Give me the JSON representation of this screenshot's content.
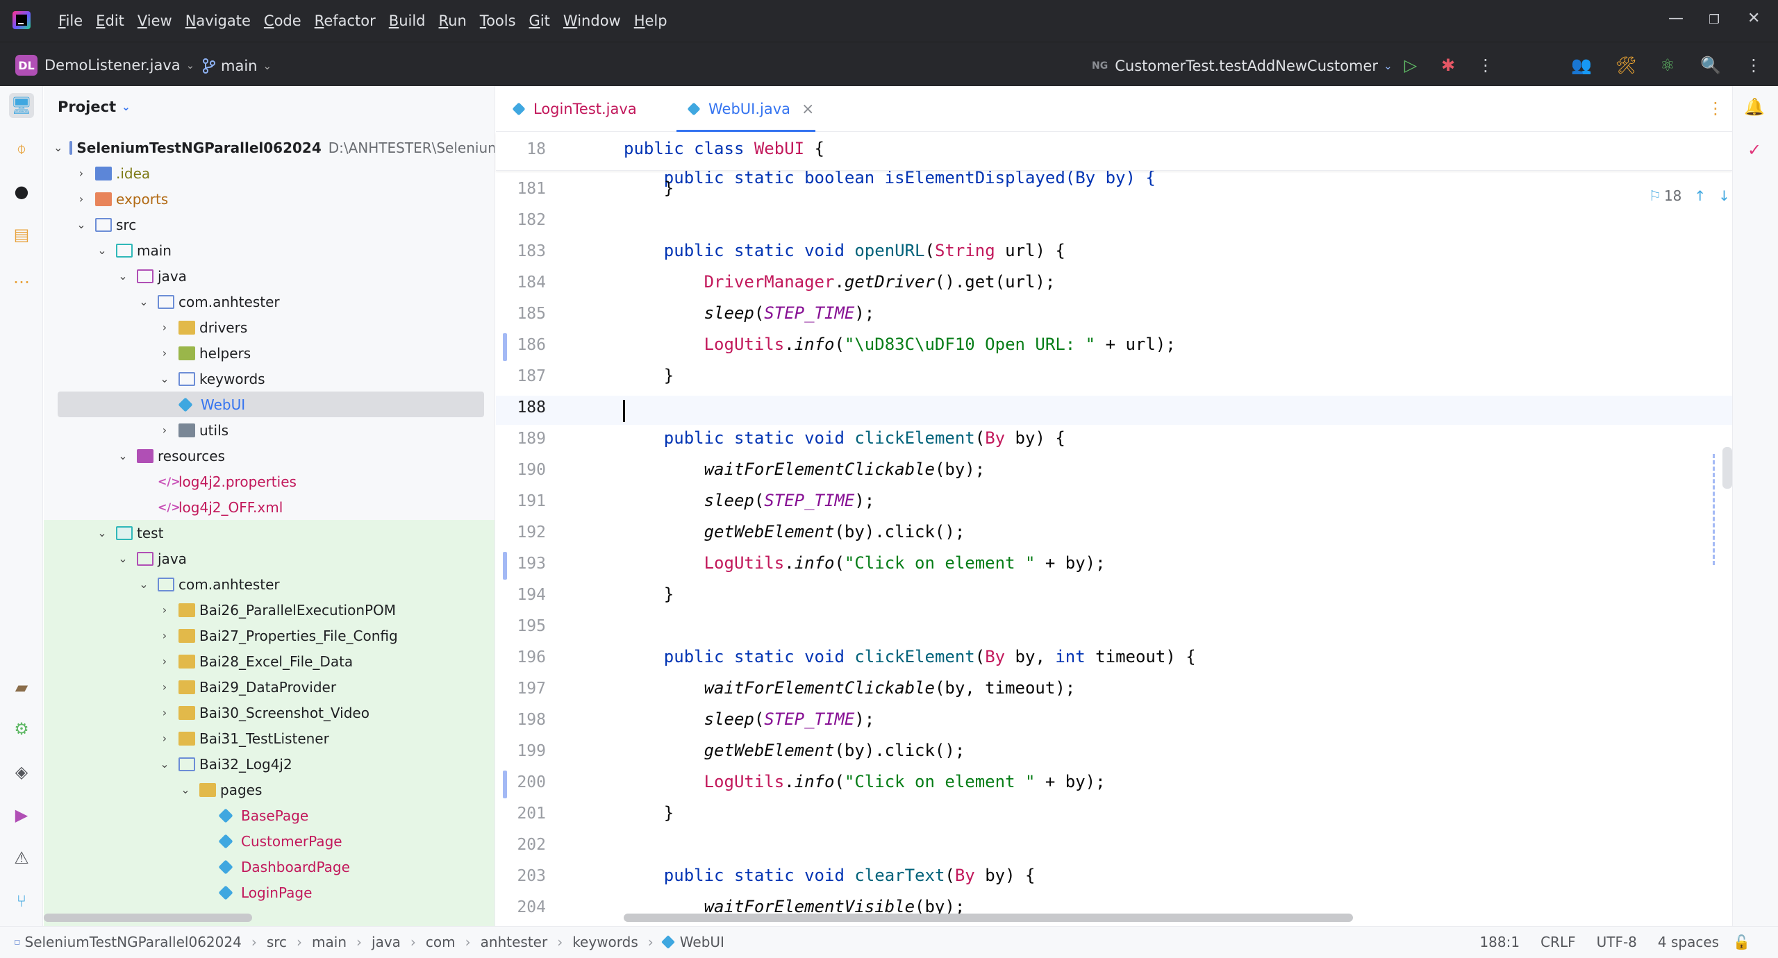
{
  "menu": {
    "items": [
      "File",
      "Edit",
      "View",
      "Navigate",
      "Code",
      "Refactor",
      "Build",
      "Run",
      "Tools",
      "Git",
      "Window",
      "Help"
    ],
    "mnemonics": [
      "F",
      "E",
      "V",
      "N",
      "C",
      "R",
      "B",
      "R",
      "T",
      "G",
      "W",
      "H"
    ]
  },
  "toolbar": {
    "project_badge": "DL",
    "project_name": "DemoListener.java",
    "branch": "main",
    "run_config_badge": "NG",
    "run_config": "CustomerTest.testAddNewCustomer"
  },
  "project_panel": {
    "title": "Project",
    "root_name": "SeleniumTestNGParallel062024",
    "root_path": "D:\\ANHTESTER\\Selenium",
    "items": [
      {
        "label": ".idea"
      },
      {
        "label": "exports"
      },
      {
        "label": "src"
      },
      {
        "label": "main"
      },
      {
        "label": "java"
      },
      {
        "label": "com.anhtester"
      },
      {
        "label": "drivers"
      },
      {
        "label": "helpers"
      },
      {
        "label": "keywords"
      },
      {
        "label": "WebUI"
      },
      {
        "label": "utils"
      },
      {
        "label": "resources"
      },
      {
        "label": "log4j2.properties"
      },
      {
        "label": "log4j2_OFF.xml"
      },
      {
        "label": "test"
      },
      {
        "label": "java"
      },
      {
        "label": "com.anhtester"
      },
      {
        "label": "Bai26_ParallelExecutionPOM"
      },
      {
        "label": "Bai27_Properties_File_Config"
      },
      {
        "label": "Bai28_Excel_File_Data"
      },
      {
        "label": "Bai29_DataProvider"
      },
      {
        "label": "Bai30_Screenshot_Video"
      },
      {
        "label": "Bai31_TestListener"
      },
      {
        "label": "Bai32_Log4j2"
      },
      {
        "label": "pages"
      },
      {
        "label": "BasePage"
      },
      {
        "label": "CustomerPage"
      },
      {
        "label": "DashboardPage"
      },
      {
        "label": "LoginPage"
      }
    ]
  },
  "editor": {
    "tabs": [
      {
        "label": "LoginTest.java"
      },
      {
        "label": "WebUI.java"
      }
    ],
    "tab_close": "×",
    "sticky_line_number": "18",
    "sticky_kw1": "public",
    "sticky_kw2": "class",
    "sticky_name": "WebUI",
    "sticky_brace": " {",
    "partial_line": "    public static boolean isElementDisplayed(By by) {",
    "inspection_count": "18",
    "line_numbers": [
      "181",
      "182",
      "183",
      "184",
      "185",
      "186",
      "187",
      "188",
      "189",
      "190",
      "191",
      "192",
      "193",
      "194",
      "195",
      "196",
      "197",
      "198",
      "199",
      "200",
      "201",
      "202",
      "203",
      "204"
    ],
    "current_line": "188",
    "code": {
      "public": "public",
      "static": "static",
      "void": "void",
      "int": "int",
      "String": "String",
      "By": "By",
      "openURL": "openURL",
      "clickElement": "clickElement",
      "clearText": "clearText",
      "DriverManager": "DriverManager",
      "getDriver": "getDriver",
      "LogUtils": "LogUtils",
      "info": "info",
      "sleep": "sleep",
      "STEP_TIME": "STEP_TIME",
      "waitForElementClickable": "waitForElementClickable",
      "waitForElementVisible": "waitForElementVisible",
      "getWebElement": "getWebElement",
      "str_open_url": "\"\\uD83C\\uDF10 Open URL: \"",
      "str_click": "\"Click on element \""
    }
  },
  "statusbar": {
    "breadcrumbs": [
      "SeleniumTestNGParallel062024",
      "src",
      "main",
      "java",
      "com",
      "anhtester",
      "keywords",
      "WebUI"
    ],
    "position": "188:1",
    "line_sep": "CRLF",
    "encoding": "UTF-8",
    "indent": "4 spaces"
  },
  "colors": {
    "accent": "#3574f0",
    "keyword": "#0033b3",
    "string": "#067d17",
    "test_folder_bg": "#e6f6e6"
  }
}
